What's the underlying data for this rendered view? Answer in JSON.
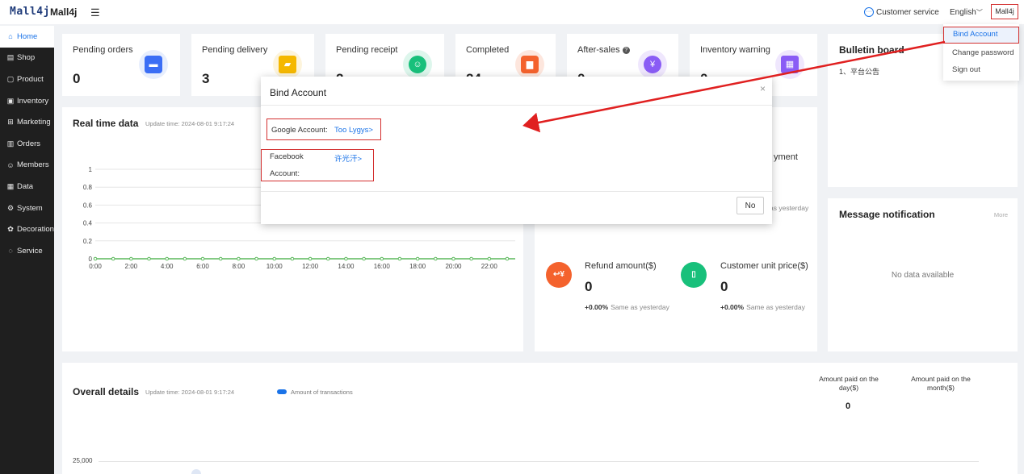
{
  "header": {
    "logo": "Mall4j",
    "app_name": "Mall4j",
    "customer_service": "Customer service",
    "language": "English",
    "user": "Mall4j"
  },
  "sidebar": {
    "items": [
      {
        "label": "Home",
        "icon": "home-icon",
        "active": true
      },
      {
        "label": "Shop",
        "icon": "shop-icon"
      },
      {
        "label": "Product",
        "icon": "product-icon"
      },
      {
        "label": "Inventory",
        "icon": "inventory-icon"
      },
      {
        "label": "Marketing",
        "icon": "gift-icon"
      },
      {
        "label": "Orders",
        "icon": "orders-icon"
      },
      {
        "label": "Members",
        "icon": "members-icon"
      },
      {
        "label": "Data",
        "icon": "data-icon"
      },
      {
        "label": "System",
        "icon": "settings-icon"
      },
      {
        "label": "Decoration",
        "icon": "decoration-icon"
      },
      {
        "label": "Service",
        "icon": "chat-icon"
      }
    ]
  },
  "stats": [
    {
      "title": "Pending orders",
      "value": "0",
      "color": "#3b6ef5",
      "bg": "#e7eefd"
    },
    {
      "title": "Pending delivery",
      "value": "3",
      "color": "#f5b800",
      "bg": "#fdf4dc"
    },
    {
      "title": "Pending receipt",
      "value": "2",
      "color": "#18c07b",
      "bg": "#ddf6ec"
    },
    {
      "title": "Completed",
      "value": "24",
      "color": "#f4622d",
      "bg": "#fde6dd"
    },
    {
      "title": "After-sales",
      "value": "0",
      "color": "#8a5cf5",
      "bg": "#efe7fd"
    },
    {
      "title": "Inventory warning",
      "value": "0",
      "color": "#8a5cf5",
      "bg": "#efe7fd"
    }
  ],
  "realtime": {
    "title": "Real time data",
    "update_label": "Update time: 2024-08-01 9:17:24"
  },
  "chart_data": {
    "type": "line",
    "x": [
      "0:00",
      "1:00",
      "2:00",
      "3:00",
      "4:00",
      "5:00",
      "6:00",
      "7:00",
      "8:00",
      "9:00",
      "10:00",
      "11:00",
      "12:00",
      "13:00",
      "14:00",
      "15:00",
      "16:00",
      "17:00",
      "18:00",
      "19:00",
      "20:00",
      "21:00",
      "22:00",
      "23:00"
    ],
    "x_tick_labels": [
      "0:00",
      "2:00",
      "4:00",
      "6:00",
      "8:00",
      "10:00",
      "12:00",
      "14:00",
      "16:00",
      "18:00",
      "20:00",
      "22:00"
    ],
    "y_tick_labels": [
      "0",
      "0.2",
      "0.4",
      "0.6",
      "0.8",
      "1"
    ],
    "series": [
      {
        "values": [
          0,
          0,
          0,
          0,
          0,
          0,
          0,
          0,
          0,
          0,
          0,
          0,
          0,
          0,
          0,
          0,
          0,
          0,
          0,
          0,
          0,
          0,
          0,
          0
        ]
      }
    ],
    "ylim": [
      0,
      1
    ],
    "grid": true,
    "line_color": "#5cb85c"
  },
  "payment": {
    "label_partial": "yment",
    "delta_partial": "as yesterday",
    "refund": {
      "title": "Refund amount($)",
      "value": "0",
      "delta": "+0.00%",
      "note": "Same as yesterday"
    },
    "unit_price": {
      "title": "Customer unit price($)",
      "value": "0",
      "delta": "+0.00%",
      "note": "Same as yesterday"
    }
  },
  "bulletin": {
    "title": "Bulletin board",
    "item": "1、平台公告"
  },
  "messages": {
    "title": "Message notification",
    "more": "More",
    "empty": "No data available"
  },
  "overall": {
    "title": "Overall details",
    "update_label": "Update time: 2024-08-01 9:17:24",
    "legend": "Amount of transactions",
    "day_label": "Amount paid on the day($)",
    "month_label": "Amount paid on the month($)",
    "day_value": "0",
    "y_tick": "25,000"
  },
  "dropdown": {
    "items": [
      "Bind Account",
      "Change password",
      "Sign out"
    ]
  },
  "modal": {
    "title": "Bind Account",
    "google_label": "Google Account:",
    "google_link": "Too Lygys>",
    "facebook_label_1": "Facebook",
    "facebook_label_2": "Account:",
    "facebook_link": "许光汗>",
    "no_button": "No",
    "close": "×"
  }
}
